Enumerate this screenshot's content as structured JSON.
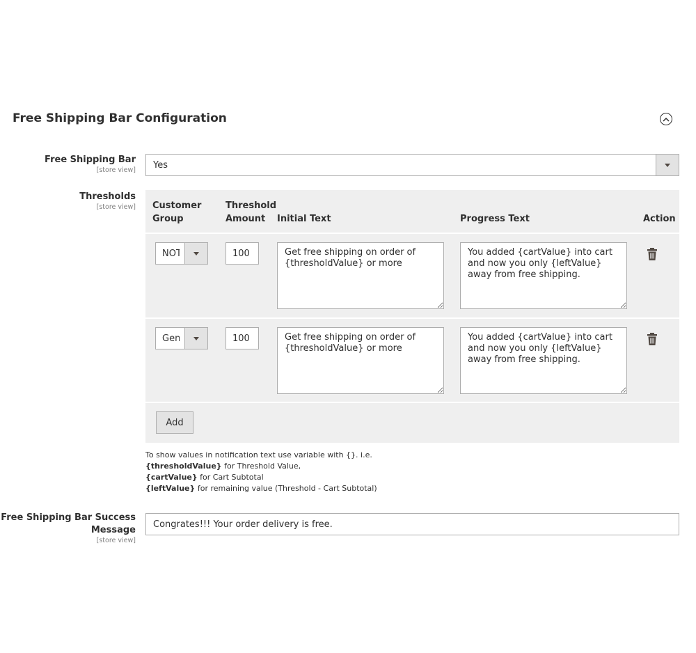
{
  "section": {
    "title": "Free Shipping Bar Configuration"
  },
  "fields": {
    "free_shipping_bar": {
      "label": "Free Shipping Bar",
      "scope": "[store view]",
      "value": "Yes"
    },
    "thresholds": {
      "label": "Thresholds",
      "scope": "[store view]"
    },
    "success_message": {
      "label_line1": "Free Shipping Bar Success",
      "label_line2": "Message",
      "scope": "[store view]",
      "value": "Congrates!!! Your order delivery is free."
    }
  },
  "table": {
    "headers": {
      "customer_group_1": "Customer",
      "customer_group_2": "Group",
      "threshold_amount_1": "Threshold",
      "threshold_amount_2": "Amount",
      "initial_text": "Initial Text",
      "progress_text": "Progress Text",
      "action": "Action"
    },
    "rows": [
      {
        "group": "NOT LOGGED IN",
        "amount": "100",
        "initial": "Get free shipping on order of {thresholdValue} or more",
        "progress": "You added {cartValue} into cart and now you only {leftValue} away from free shipping."
      },
      {
        "group": "General",
        "amount": "100",
        "initial": "Get free shipping on order of {thresholdValue} or more",
        "progress": "You added {cartValue} into cart and now you only {leftValue} away from free shipping."
      }
    ],
    "add_label": "Add"
  },
  "note": {
    "line1": "To show values in notification text use variable with {}. i.e.",
    "threshold_var": "{thresholdValue}",
    "threshold_desc": " for Threshold Value,",
    "cart_var": "{cartValue}",
    "cart_desc": " for Cart Subtotal",
    "left_var": "{leftValue}",
    "left_desc": " for remaining value (Threshold - Cart Subtotal)"
  },
  "icons": {
    "collapse": "chevron-up-circle-icon",
    "delete": "trash-icon",
    "dropdown": "triangle-down-icon"
  }
}
